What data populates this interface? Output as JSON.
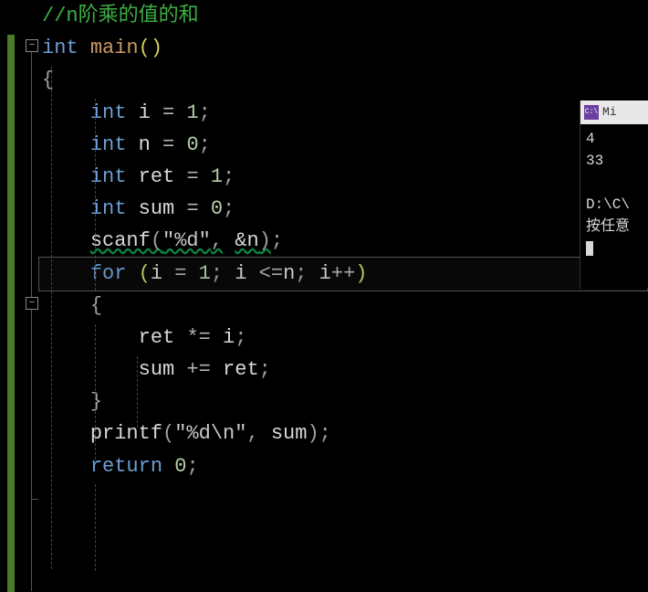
{
  "code": {
    "comment": "//n阶乘的值的和",
    "kw_int": "int",
    "main": "main",
    "lparen": "(",
    "rparen": ")",
    "lbrace": "{",
    "rbrace": "}",
    "var_i": "i",
    "var_n": "n",
    "var_ret": "ret",
    "var_sum": "sum",
    "eq": "=",
    "num_0": "0",
    "num_1": "1",
    "semi": ";",
    "scanf": "scanf",
    "fmt_d": "\"%d\"",
    "comma": ",",
    "amp_n": "&n",
    "kw_for": "for",
    "lte": "<=",
    "inc": "++",
    "star_eq": "*=",
    "plus_eq": "+=",
    "printf": "printf",
    "fmt_dn": "\"%d\\n\"",
    "kw_return": "return"
  },
  "fold": {
    "minus": "−"
  },
  "console": {
    "title": "Mi",
    "icon": "C:\\",
    "out1": "4",
    "out2": "33",
    "path": "D:\\C\\",
    "prompt": "按任意"
  }
}
